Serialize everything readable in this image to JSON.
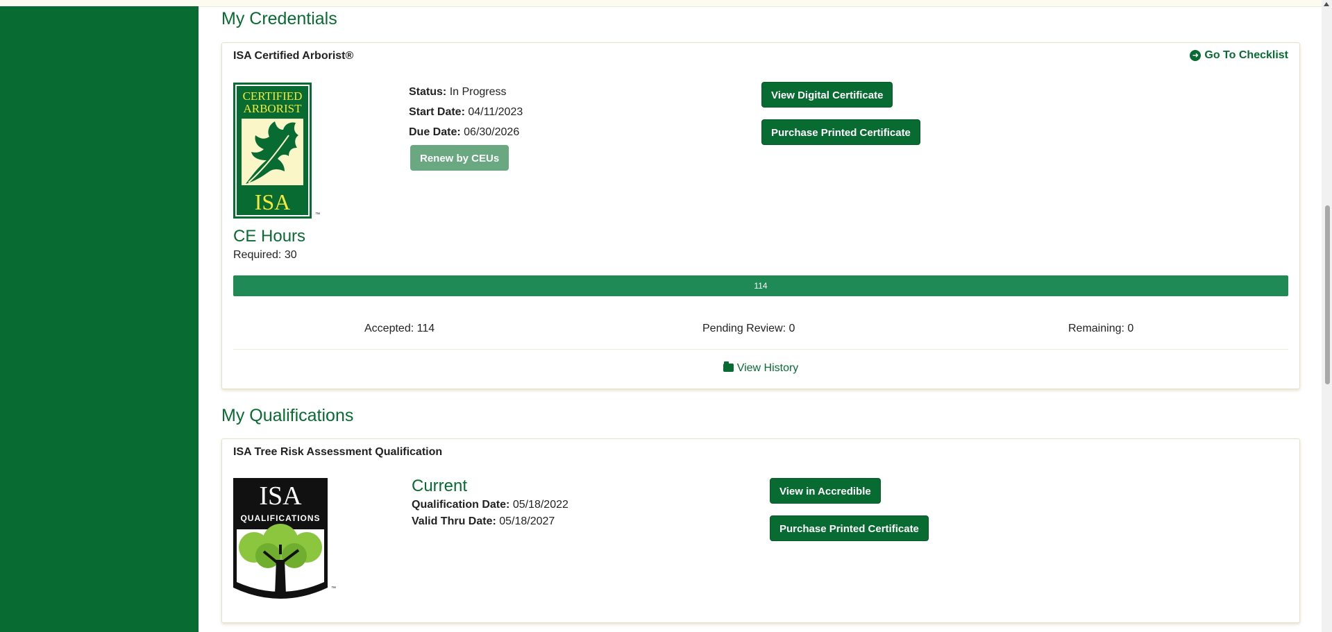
{
  "credentials": {
    "heading": "My Credentials",
    "card": {
      "title": "ISA Certified Arborist®",
      "checklist_link": "Go To Checklist",
      "logo": {
        "line1": "CERTIFIED",
        "line2": "ARBORIST",
        "mark": "ISA",
        "tm": "™"
      },
      "status_label": "Status:",
      "status_value": "In Progress",
      "start_label": "Start Date:",
      "start_value": "04/11/2023",
      "due_label": "Due Date:",
      "due_value": "06/30/2026",
      "renew_button": "Renew by CEUs",
      "view_digital_button": "View Digital Certificate",
      "purchase_button": "Purchase Printed Certificate",
      "ce_title": "CE Hours",
      "required_text": "Required: 30",
      "progress_label": "114",
      "progress_fraction": 1.0,
      "accepted_text": "Accepted: 114",
      "pending_text": "Pending Review: 0",
      "remaining_text": "Remaining: 0",
      "history_link": "View History"
    }
  },
  "qualifications": {
    "heading": "My Qualifications",
    "card": {
      "title": "ISA Tree Risk Assessment Qualification",
      "logo": {
        "mark": "ISA",
        "caption": "QUALIFICATIONS",
        "tm": "™"
      },
      "status": "Current",
      "qual_date_label": "Qualification Date:",
      "qual_date_value": "05/18/2022",
      "valid_label": "Valid Thru Date:",
      "valid_value": "05/18/2027",
      "accredible_button": "View in Accredible",
      "purchase_button": "Purchase Printed Certificate"
    }
  },
  "colors": {
    "brand_green": "#086b32",
    "progress_green": "#1f8a55",
    "logo_yellow": "#f5e93b",
    "leaf_light_green": "#8cc63f"
  }
}
